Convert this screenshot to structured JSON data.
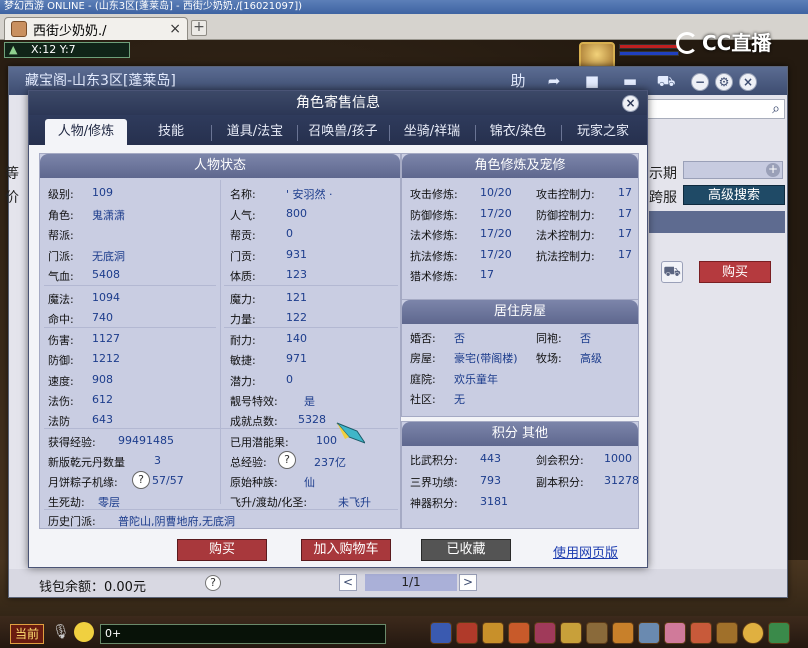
{
  "os_title": "梦幻西游 ONLINE  -  (山东3区[蓬莱岛]  - 西街少奶奶./[16021097])",
  "browser": {
    "tab_label": "西街少奶奶./",
    "tab_close": "×",
    "new_tab": "+"
  },
  "hud": {
    "coord_icon": "triangle-icon",
    "coords": "X:12 Y:7",
    "cc_brand": "CC直播"
  },
  "outer": {
    "title": "藏宝阁-山东3区[蓬莱岛]",
    "tool_help": "助",
    "side_label_1": "等",
    "side_label_2": "价",
    "side_label_3": "示期",
    "side_label_4": "跨服",
    "adv_search": "高级搜索",
    "buy": "购买",
    "wallet": "钱包余额：0.00元",
    "help_q": "?",
    "pager_prev": "<",
    "pager_page": "1/1",
    "pager_next": ">"
  },
  "dialog": {
    "title": "角色寄售信息",
    "close": "×",
    "tabs": [
      {
        "label": "人物/修炼",
        "active": true
      },
      {
        "label": "技能"
      },
      {
        "label": "道具/法宝"
      },
      {
        "label": "召唤兽/孩子"
      },
      {
        "label": "坐骑/祥瑞"
      },
      {
        "label": "锦衣/染色"
      },
      {
        "label": "玩家之家"
      }
    ],
    "status_head": "人物状态",
    "cultivation_head": "角色修炼及宠修",
    "house_head": "居住房屋",
    "score_head": "积分 其他",
    "left_col": [
      {
        "k": "级别:",
        "v": "109"
      },
      {
        "k": "角色:",
        "v": "鬼潇潇"
      },
      {
        "k": "帮派:",
        "v": ""
      },
      {
        "k": "门派:",
        "v": "无底洞"
      },
      {
        "k": "气血:",
        "v": "5408"
      },
      {
        "k": "魔法:",
        "v": "1094"
      },
      {
        "k": "命中:",
        "v": "740"
      },
      {
        "k": "伤害:",
        "v": "1127"
      },
      {
        "k": "防御:",
        "v": "1212"
      },
      {
        "k": "速度:",
        "v": "908"
      },
      {
        "k": "法伤:",
        "v": "612"
      },
      {
        "k": "法防",
        "v": "643"
      }
    ],
    "right_col": [
      {
        "k": "名称:",
        "v": "' 安羽然 ·"
      },
      {
        "k": "人气:",
        "v": "800"
      },
      {
        "k": "帮贡:",
        "v": "0"
      },
      {
        "k": "门贡:",
        "v": "931"
      },
      {
        "k": "体质:",
        "v": "123"
      },
      {
        "k": "魔力:",
        "v": "121"
      },
      {
        "k": "力量:",
        "v": "122"
      },
      {
        "k": "耐力:",
        "v": "140"
      },
      {
        "k": "敏捷:",
        "v": "971"
      },
      {
        "k": "潜力:",
        "v": "0"
      },
      {
        "k": "靓号特效:",
        "v": "是"
      },
      {
        "k": "成就点数:",
        "v": "5328"
      }
    ],
    "extra": {
      "exp_k": "获得经验:",
      "exp_v": "99491485",
      "used_pot_k": "已用潜能果:",
      "used_pot_v": "100",
      "qiankun_k": "新版乾元丹数量",
      "qiankun_v": "3",
      "total_exp_k": "总经验:",
      "total_exp_q": "?",
      "total_exp_v": "237亿",
      "mooncake_k": "月饼粽子机缘:",
      "mooncake_q": "?",
      "mooncake_v": "57/57",
      "race_k": "原始种族:",
      "race_v": "仙",
      "life_k": "生死劫:",
      "life_v": "零层",
      "fly_k": "飞升/渡劫/化圣:",
      "fly_v": "未飞升",
      "history_k": "历史门派:",
      "history_v": "普陀山,阴曹地府,无底洞"
    },
    "cultivation": [
      {
        "k": "攻击修炼:",
        "v": "10/20",
        "k2": "攻击控制力:",
        "v2": "17"
      },
      {
        "k": "防御修炼:",
        "v": "17/20",
        "k2": "防御控制力:",
        "v2": "17"
      },
      {
        "k": "法术修炼:",
        "v": "17/20",
        "k2": "法术控制力:",
        "v2": "17"
      },
      {
        "k": "抗法修炼:",
        "v": "17/20",
        "k2": "抗法控制力:",
        "v2": "17"
      },
      {
        "k": "猎术修炼:",
        "v": "17",
        "k2": "",
        "v2": ""
      }
    ],
    "house": [
      {
        "k": "婚否:",
        "v": "否",
        "k2": "同袍:",
        "v2": "否"
      },
      {
        "k": "房屋:",
        "v": "豪宅(带阁楼)",
        "k2": "牧场:",
        "v2": "高级"
      },
      {
        "k": "庭院:",
        "v": "欢乐童年",
        "k2": "",
        "v2": ""
      },
      {
        "k": "社区:",
        "v": "无",
        "k2": "",
        "v2": ""
      }
    ],
    "scores": [
      {
        "k": "比武积分:",
        "v": "443",
        "k2": "剑会积分:",
        "v2": "1000"
      },
      {
        "k": "三界功绩:",
        "v": "793",
        "k2": "副本积分:",
        "v2": "31278"
      },
      {
        "k": "神器积分:",
        "v": "3181",
        "k2": "",
        "v2": ""
      }
    ],
    "btn_buy": "购买",
    "btn_cart": "加入购物车",
    "btn_fav": "已收藏",
    "link_web": "使用网页版"
  },
  "bottom": {
    "channel": "当前",
    "chat_placeholder": "0+"
  },
  "colors": {
    "dialog_title_bg": "#2c3756",
    "panel_bg": "#c9cde2",
    "value_text": "#1c3c8c",
    "buy_red": "#a8383c"
  }
}
